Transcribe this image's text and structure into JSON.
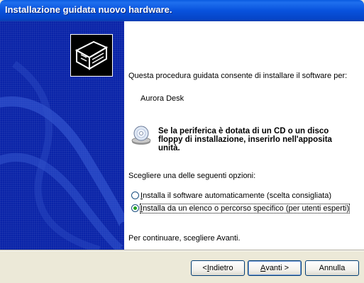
{
  "window": {
    "title": "Installazione guidata nuovo hardware."
  },
  "wizard": {
    "intro": "Questa procedura guidata consente di installare il software per:",
    "device_name": "Aurora Desk",
    "cd_notice": "Se la periferica è dotata di un CD o un disco floppy di installazione, inserirlo nell'apposita unità.",
    "prompt": "Scegliere una delle seguenti opzioni:",
    "options": [
      {
        "mnemonic": "I",
        "label_rest": "nstalla il software automaticamente (scelta consigliata)",
        "selected": false
      },
      {
        "mnemonic": "I",
        "label_rest": "nstalla da un elenco o percorso specifico (per utenti esperti)",
        "selected": true
      }
    ],
    "continue_text": "Per continuare, scegliere Avanti."
  },
  "buttons": {
    "back_prefix": "< ",
    "back_mnemonic": "I",
    "back_rest": "ndietro",
    "next_mnemonic": "A",
    "next_rest": "vanti >",
    "cancel": "Annulla"
  },
  "colors": {
    "title_bar": "#0852dd",
    "side_panel": "#0a24a8",
    "dialog_bg": "#ece9d8",
    "radio_dot": "#21a121"
  },
  "icons": [
    "hardware-card-icon",
    "cd-disc-icon"
  ]
}
